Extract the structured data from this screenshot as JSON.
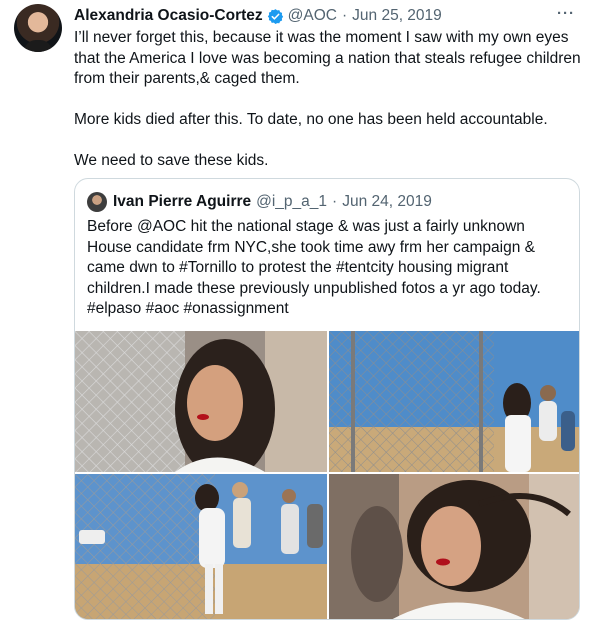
{
  "tweet": {
    "author_name": "Alexandria Ocasio-Cortez",
    "handle": "@AOC",
    "separator": "·",
    "date": "Jun 25, 2019",
    "more_label": "···",
    "paragraphs": [
      "I’ll never forget this, because it was the moment I saw with my own eyes that the America I love was becoming a nation that steals refugee children from their parents,& caged them.",
      "More kids died after this. To date, no one has been held accountable.",
      "We need to save these kids."
    ]
  },
  "quoted_tweet": {
    "author_name": "Ivan Pierre Aguirre",
    "handle": "@i_p_a_1",
    "separator": "·",
    "date": "Jun 24, 2019",
    "text": "Before @AOC hit the national stage & was just a fairly unknown House candidate frm NYC,she took time awy frm her campaign & came dwn to #Tornillo to protest the #tentcity housing migrant children.I made these previously unpublished fotos a yr ago today. #elpaso #aoc #onassignment",
    "photo_count": 4
  },
  "colors": {
    "text": "#0f1419",
    "secondary_text": "#536471",
    "verified_badge": "#1d9bf0",
    "border": "#cfd9de"
  },
  "icons": {
    "verified": "verified-badge-icon",
    "more": "more-options-icon"
  }
}
